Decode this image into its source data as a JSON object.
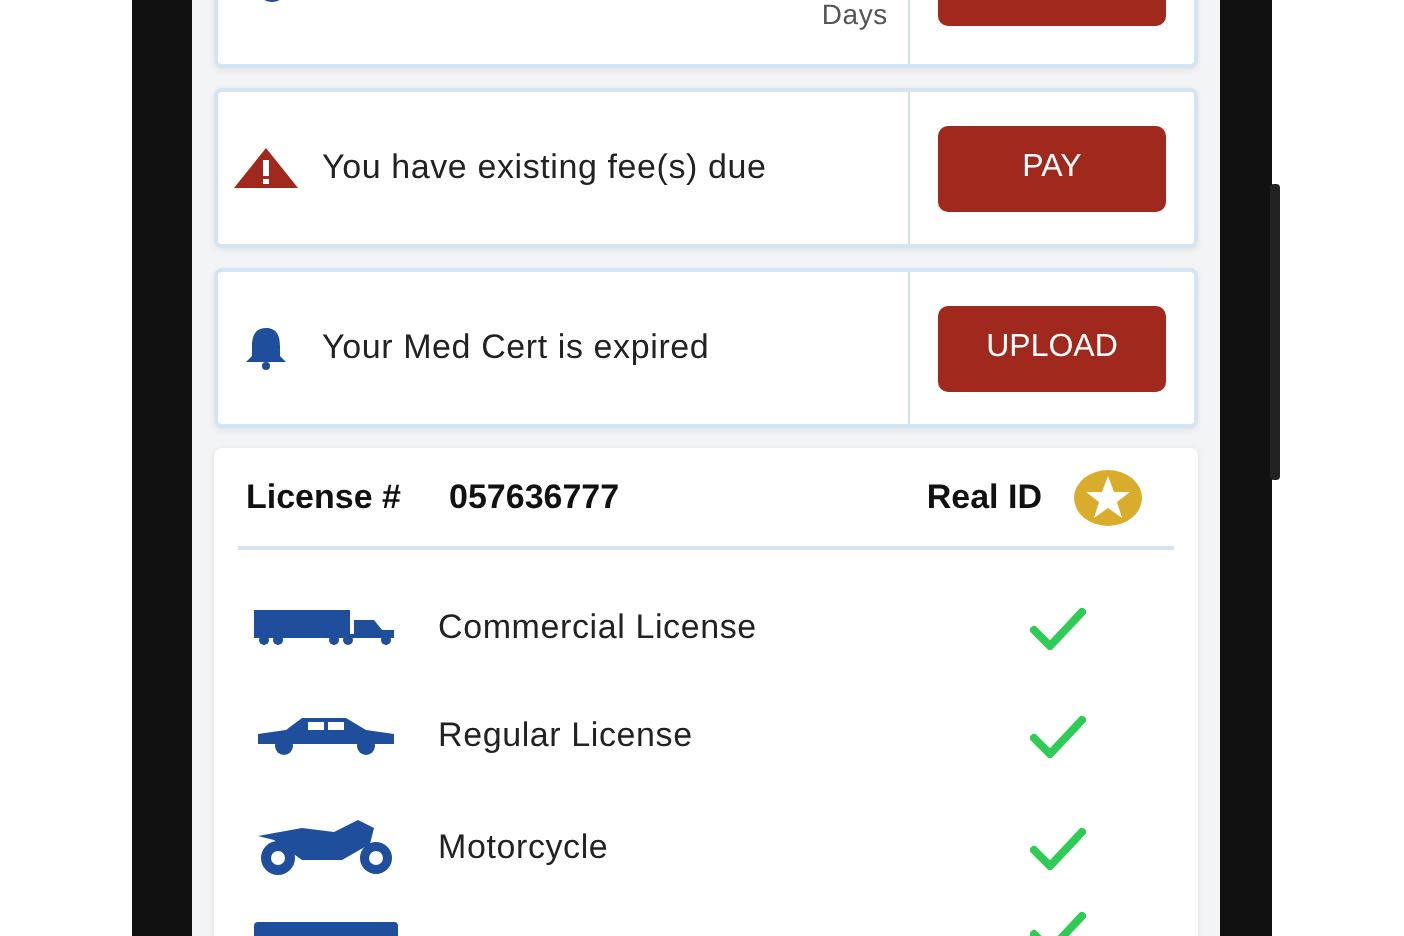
{
  "alerts": [
    {
      "text": "Days",
      "kind": "partial"
    },
    {
      "text": "You have existing fee(s) due",
      "button": "PAY",
      "kind": "full"
    },
    {
      "text": "Your Med Cert is expired",
      "button": "UPLOAD",
      "kind": "full"
    }
  ],
  "license": {
    "label": "License #",
    "number": "057636777",
    "real_id": "Real ID",
    "real_id_star": true,
    "classes": [
      {
        "label": "Commercial License",
        "checked": true
      },
      {
        "label": "Regular License",
        "checked": true
      },
      {
        "label": "Motorcycle",
        "checked": true
      },
      {
        "checked": true
      }
    ]
  }
}
